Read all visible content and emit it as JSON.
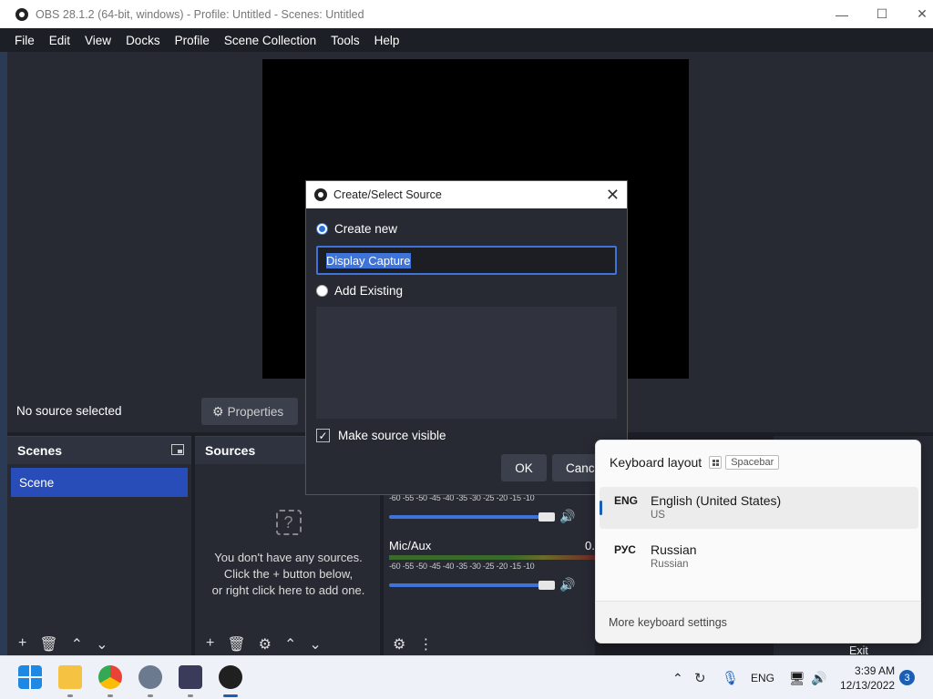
{
  "window": {
    "title": "OBS 28.1.2 (64-bit, windows) - Profile: Untitled - Scenes: Untitled",
    "minimize": "—",
    "maximize": "☐",
    "close": "✕"
  },
  "menu": [
    "File",
    "Edit",
    "View",
    "Docks",
    "Profile",
    "Scene Collection",
    "Tools",
    "Help"
  ],
  "source_bar": {
    "status": "No source selected",
    "properties_label": "Properties"
  },
  "scenes": {
    "header": "Scenes",
    "items": [
      "Scene"
    ]
  },
  "sources": {
    "header": "Sources",
    "empty_line1": "You don't have any sources.",
    "empty_line2": "Click the + button below,",
    "empty_line3": "or right click here to add one."
  },
  "mixer": {
    "ticks": "-60 -55 -50 -45 -40 -35 -30 -25 -20 -15 -10",
    "channel2_label": "Mic/Aux",
    "channel2_value": "0."
  },
  "controls": {
    "exit_label": "Exit"
  },
  "dialog": {
    "title": "Create/Select Source",
    "create_new_label": "Create new",
    "name_value": "Display Capture",
    "add_existing_label": "Add Existing",
    "visible_label": "Make source visible",
    "ok_label": "OK",
    "cancel_label": "Cance"
  },
  "keyboard_popup": {
    "title": "Keyboard layout",
    "shortcut": "Spacebar",
    "layouts": [
      {
        "code": "ENG",
        "name": "English (United States)",
        "sub": "US"
      },
      {
        "code": "РУС",
        "name": "Russian",
        "sub": "Russian"
      }
    ],
    "footer": "More keyboard settings"
  },
  "taskbar": {
    "language": "ENG",
    "time": "3:39 AM",
    "date": "12/13/2022",
    "notification_count": "3"
  },
  "colors": {
    "accent": "#284cb8",
    "bg": "#1d1f26",
    "panel": "#272a33"
  }
}
